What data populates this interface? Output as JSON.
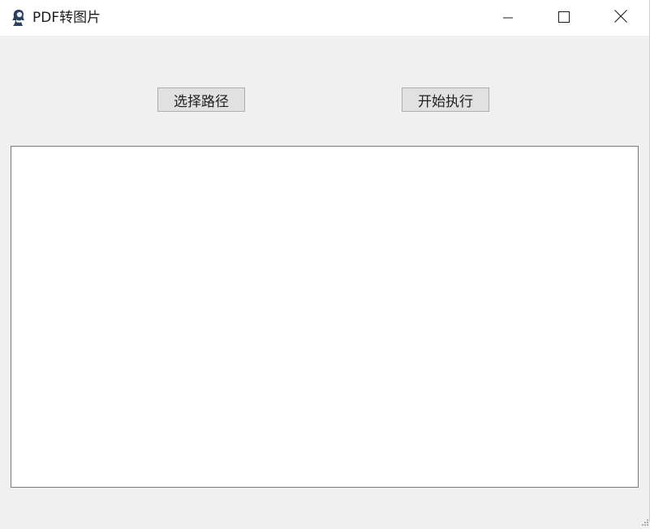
{
  "window": {
    "title": "PDF转图片",
    "icon": "app-icon",
    "controls": [
      "minimize-icon",
      "maximize-icon",
      "close-icon"
    ]
  },
  "toolbar": {
    "select_path_label": "选择路径",
    "start_label": "开始执行"
  },
  "output": {
    "text": ""
  }
}
